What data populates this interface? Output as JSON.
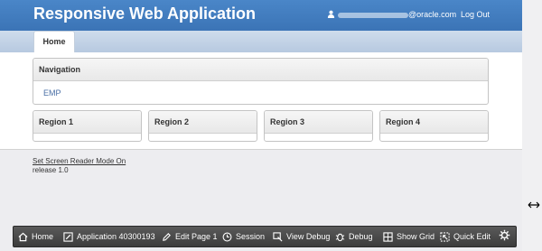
{
  "header": {
    "app_title": "Responsive Web Application",
    "user_email_suffix": "@oracle.com",
    "logout_label": "Log Out"
  },
  "tabs": [
    {
      "label": "Home"
    }
  ],
  "navigation": {
    "title": "Navigation",
    "items": [
      {
        "label": "EMP"
      }
    ]
  },
  "regions": [
    {
      "title": "Region 1"
    },
    {
      "title": "Region 2"
    },
    {
      "title": "Region 3"
    },
    {
      "title": "Region 4"
    }
  ],
  "footer": {
    "screen_reader_link": "Set Screen Reader Mode On",
    "release": "release 1.0"
  },
  "dev_toolbar": {
    "home": "Home",
    "application": "Application 40300193",
    "edit_page": "Edit Page 1",
    "session": "Session",
    "view_debug": "View Debug",
    "debug": "Debug",
    "show_grid": "Show Grid",
    "quick_edit": "Quick Edit"
  },
  "icons": {
    "user": "user-icon",
    "gear": "gear-icon",
    "resize": "resize-arrow-icon"
  },
  "colors": {
    "header_blue": "#3b74b6",
    "link_blue": "#4a6fa5",
    "dev_toolbar": "#444444"
  }
}
